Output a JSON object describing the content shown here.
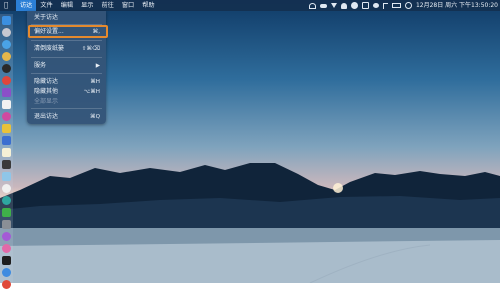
{
  "menubar": {
    "items": [
      "访达",
      "文件",
      "编辑",
      "显示",
      "前往",
      "窗口",
      "帮助"
    ],
    "clock": "12月28日 周六 下午13:50:20"
  },
  "menu": {
    "items": [
      {
        "label": "关于访达",
        "shortcut": ""
      },
      {
        "label": "偏好设置...",
        "shortcut": "⌘,"
      },
      {
        "label": "清倒废纸篓",
        "shortcut": "⇧⌘⌫"
      },
      {
        "label": "服务",
        "shortcut": "▶"
      },
      {
        "label": "隐藏访达",
        "shortcut": "⌘H"
      },
      {
        "label": "隐藏其他",
        "shortcut": "⌥⌘H"
      },
      {
        "label": "全部显示",
        "shortcut": ""
      },
      {
        "label": "退出访达",
        "shortcut": "⌘Q"
      }
    ]
  },
  "status_icons": [
    "apple-icon",
    "wifi-icon",
    "cloud-icon",
    "download-icon",
    "bell-icon",
    "ghost-icon",
    "s-icon",
    "wechat-icon",
    "music-icon",
    "battery-icon",
    "clock-icon"
  ],
  "colors": {
    "menubar": "#14304f",
    "menu_bg": "#345478",
    "highlight": "#e58a2e",
    "active": "#2b7fd6"
  }
}
